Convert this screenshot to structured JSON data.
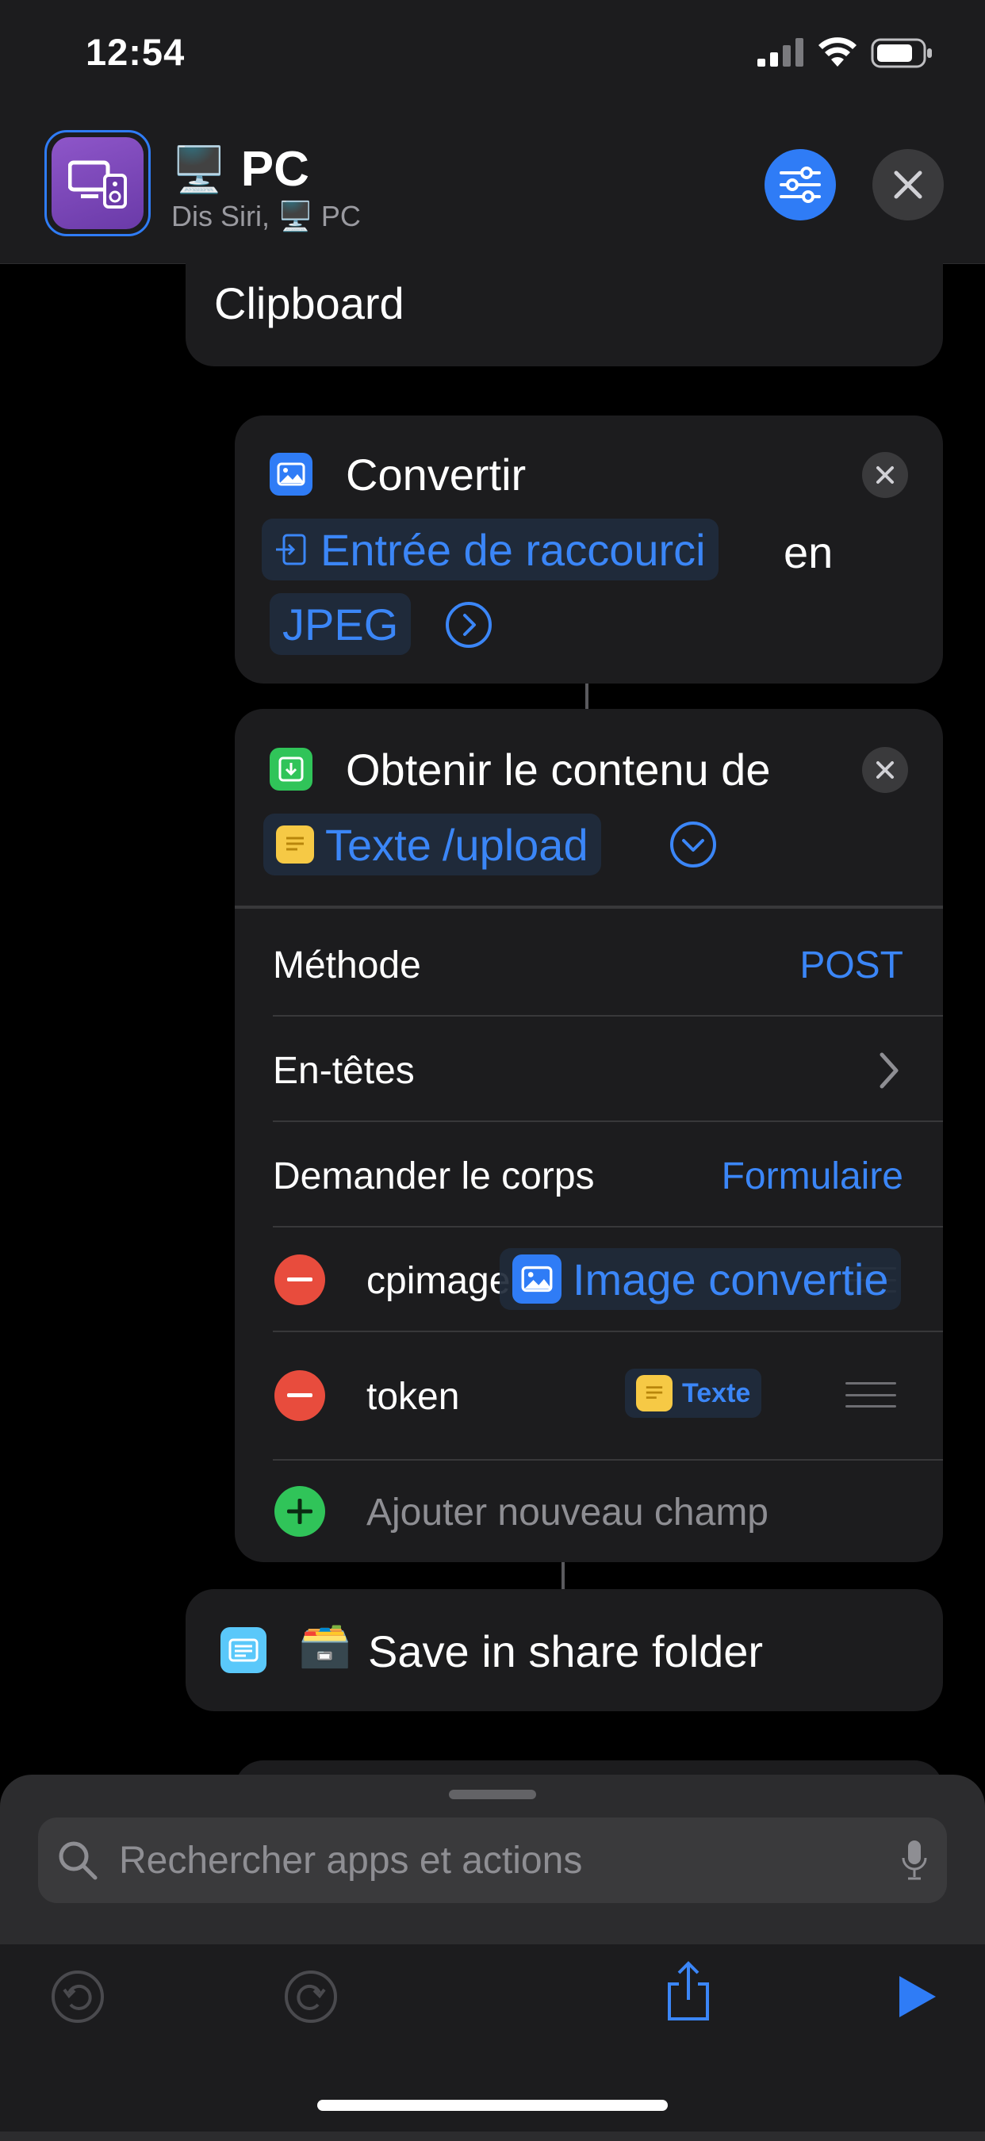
{
  "status_bar": {
    "time": "12:54"
  },
  "header": {
    "title_emoji": "🖥️",
    "title": "PC",
    "subtitle_prefix": "Dis Siri,",
    "subtitle_emoji": "🖥️",
    "subtitle_name": "PC"
  },
  "clipboard_card": {
    "label": "Clipboard"
  },
  "convert_action": {
    "title": "Convertir",
    "input_token": "Entrée de raccourci",
    "connector_word": "en",
    "format": "JPEG"
  },
  "get_contents_action": {
    "title": "Obtenir le contenu de",
    "url_token": "Texte",
    "url_suffix": "/upload",
    "rows": {
      "method_label": "Méthode",
      "method_value": "POST",
      "headers_label": "En-têtes",
      "body_label": "Demander le corps",
      "body_value": "Formulaire"
    },
    "fields": [
      {
        "key": "cpimage",
        "value": "Image convertie"
      },
      {
        "key": "token",
        "value": "Texte"
      }
    ],
    "add_field_label": "Ajouter nouveau champ"
  },
  "save_action": {
    "emoji": "🗃️",
    "title": "Save in share folder"
  },
  "search": {
    "placeholder": "Rechercher apps et actions"
  },
  "colors": {
    "accent": "#3b86f7",
    "card": "#1c1c1e",
    "destructive": "#e84c3d",
    "add": "#30c459",
    "app_icon": "#7b49b8"
  },
  "icons": [
    "signal-icon",
    "wifi-icon",
    "battery-icon",
    "monitor-icon",
    "settings-sliders-icon",
    "close-icon",
    "photo-icon",
    "download-icon",
    "text-doc-icon",
    "chevron-right-circle-icon",
    "chevron-down-circle-icon",
    "chevron-right-icon",
    "minus-icon",
    "plus-icon",
    "reorder-icon",
    "shortcut-icon",
    "search-icon",
    "microphone-icon",
    "undo-icon",
    "redo-icon",
    "share-icon",
    "play-icon"
  ]
}
